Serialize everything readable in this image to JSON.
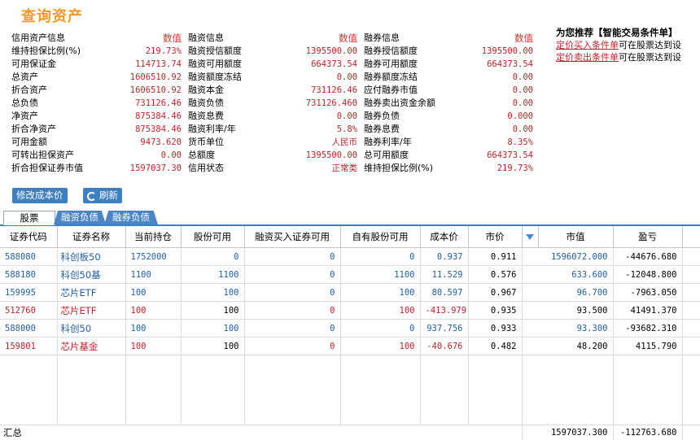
{
  "title": "查询资产",
  "info": {
    "col1": [
      {
        "label": "信用资产信息",
        "value": "数值"
      },
      {
        "label": "维持担保比例(%)",
        "value": "219.73%"
      },
      {
        "label": "可用保证金",
        "value": "114713.74"
      },
      {
        "label": "总资产",
        "value": "1606510.92"
      },
      {
        "label": "折合资产",
        "value": "1606510.92"
      },
      {
        "label": "总负债",
        "value": "731126.46"
      },
      {
        "label": "净资产",
        "value": "875384.46"
      },
      {
        "label": "折合净资产",
        "value": "875384.46"
      },
      {
        "label": "可用金额",
        "value": "9473.620"
      },
      {
        "label": "可转出担保资产",
        "value": "0.00"
      },
      {
        "label": "折合担保证券市值",
        "value": "1597037.30"
      }
    ],
    "col2": [
      {
        "label": "融资信息",
        "value": "数值"
      },
      {
        "label": "融资授信额度",
        "value": "1395500.00"
      },
      {
        "label": "融资可用额度",
        "value": "664373.54"
      },
      {
        "label": "融资额度冻结",
        "value": "0.00"
      },
      {
        "label": "融资本金",
        "value": "731126.46"
      },
      {
        "label": "融资负债",
        "value": "731126.460"
      },
      {
        "label": "融资息费",
        "value": "0.00"
      },
      {
        "label": "融资利率/年",
        "value": "5.8%"
      },
      {
        "label": "货币单位",
        "value": "人民币"
      },
      {
        "label": "总额度",
        "value": "1395500.00"
      },
      {
        "label": "信用状态",
        "value": "正常类"
      }
    ],
    "col3": [
      {
        "label": "融券信息",
        "value": "数值"
      },
      {
        "label": "融券授信额度",
        "value": "1395500.00"
      },
      {
        "label": "融券可用额度",
        "value": "664373.54"
      },
      {
        "label": "融券额度冻结",
        "value": "0.00"
      },
      {
        "label": "应付融券市值",
        "value": "0.00"
      },
      {
        "label": "融券卖出资金余额",
        "value": "0.00"
      },
      {
        "label": "融券负债",
        "value": "0.000"
      },
      {
        "label": "融券息费",
        "value": "0.00"
      },
      {
        "label": "融券利率/年",
        "value": "8.35%"
      },
      {
        "label": "总可用额度",
        "value": "664373.54"
      },
      {
        "label": "维持担保比例(%)",
        "value": "219.73%"
      }
    ]
  },
  "promo": {
    "heading": "为您推荐【智能交易条件单】",
    "line1_link": "定价买入条件单",
    "line1_text": "可在股票达到设",
    "line2_link": "定价卖出条件单",
    "line2_text": "可在股票达到设"
  },
  "buttons": {
    "modify_cost": "修改成本价",
    "refresh": "刷新"
  },
  "tabs": [
    "股票",
    "融资负债",
    "融券负债"
  ],
  "table": {
    "headers": [
      "证券代码",
      "证券名称",
      "当前持仓",
      "股份可用",
      "融资买入证券可用",
      "自有股份可用",
      "成本价",
      "市价",
      "",
      "市值",
      "盈亏"
    ],
    "rows": [
      {
        "color": "blue",
        "cells": [
          "588080",
          "科创板50",
          "1752000",
          "0",
          "0",
          "0",
          "0.937",
          "0.911",
          "1596072.000",
          "-44676.680"
        ]
      },
      {
        "color": "blue",
        "cells": [
          "588180",
          "科创50基",
          "1100",
          "1100",
          "0",
          "1100",
          "11.529",
          "0.576",
          "633.600",
          "-12048.800"
        ]
      },
      {
        "color": "blue",
        "cells": [
          "159995",
          "芯片ETF",
          "100",
          "100",
          "0",
          "100",
          "80.597",
          "0.967",
          "96.700",
          "-7963.050"
        ]
      },
      {
        "color": "red",
        "cells": [
          "512760",
          "芯片ETF",
          "100",
          "100",
          "0",
          "100",
          "-413.979",
          "0.935",
          "93.500",
          "41491.370"
        ]
      },
      {
        "color": "blue",
        "cells": [
          "588000",
          "科创50",
          "100",
          "100",
          "0",
          "0",
          "937.756",
          "0.933",
          "93.300",
          "-93682.310"
        ]
      },
      {
        "color": "red",
        "cells": [
          "159801",
          "芯片基金",
          "100",
          "100",
          "0",
          "100",
          "-40.676",
          "0.482",
          "48.200",
          "4115.790"
        ]
      }
    ],
    "summary": {
      "label": "汇总",
      "market_value": "1597037.300",
      "pnl": "-112763.680"
    }
  }
}
